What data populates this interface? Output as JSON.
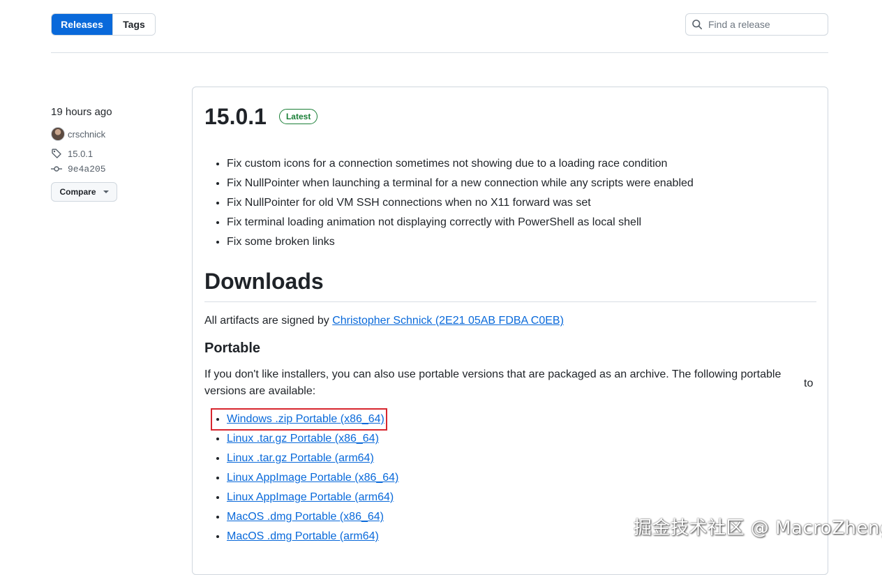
{
  "nav": {
    "releases_label": "Releases",
    "tags_label": "Tags",
    "active_tab": "Releases"
  },
  "search": {
    "placeholder": "Find a release",
    "value": ""
  },
  "meta": {
    "time_ago": "19 hours ago",
    "author": "crschnick",
    "tag": "15.0.1",
    "commit": "9e4a205",
    "compare_label": "Compare"
  },
  "release": {
    "version": "15.0.1",
    "badge": "Latest",
    "notes": [
      "Fix custom icons for a connection sometimes not showing due to a loading race condition",
      "Fix NullPointer when launching a terminal for a new connection while any scripts were enabled",
      "Fix NullPointer for old VM SSH connections when no X11 forward was set",
      "Fix terminal loading animation not displaying correctly with PowerShell as local shell",
      "Fix some broken links"
    ],
    "downloads_heading": "Downloads",
    "signed_prefix": "All artifacts are signed by ",
    "signed_link": "Christopher Schnick (2E21 05AB FDBA C0EB)",
    "portable_heading": "Portable",
    "portable_description": "If you don't like installers, you can also use portable versions that are packaged as an archive. The following portable versions are available:",
    "stray_text": "to",
    "portable_links": [
      "Windows .zip Portable (x86_64)",
      "Linux .tar.gz Portable (x86_64)",
      "Linux .tar.gz Portable (arm64)",
      "Linux AppImage Portable (x86_64)",
      "Linux AppImage Portable (arm64)",
      "MacOS .dmg Portable (x86_64)",
      "MacOS .dmg Portable (arm64)"
    ]
  },
  "watermark": "掘金技术社区 @ MacroZheng",
  "colors": {
    "primary": "#0969da",
    "latest_green": "#1a7f37",
    "highlight_red": "#d7262e",
    "border": "#d0d7de"
  }
}
